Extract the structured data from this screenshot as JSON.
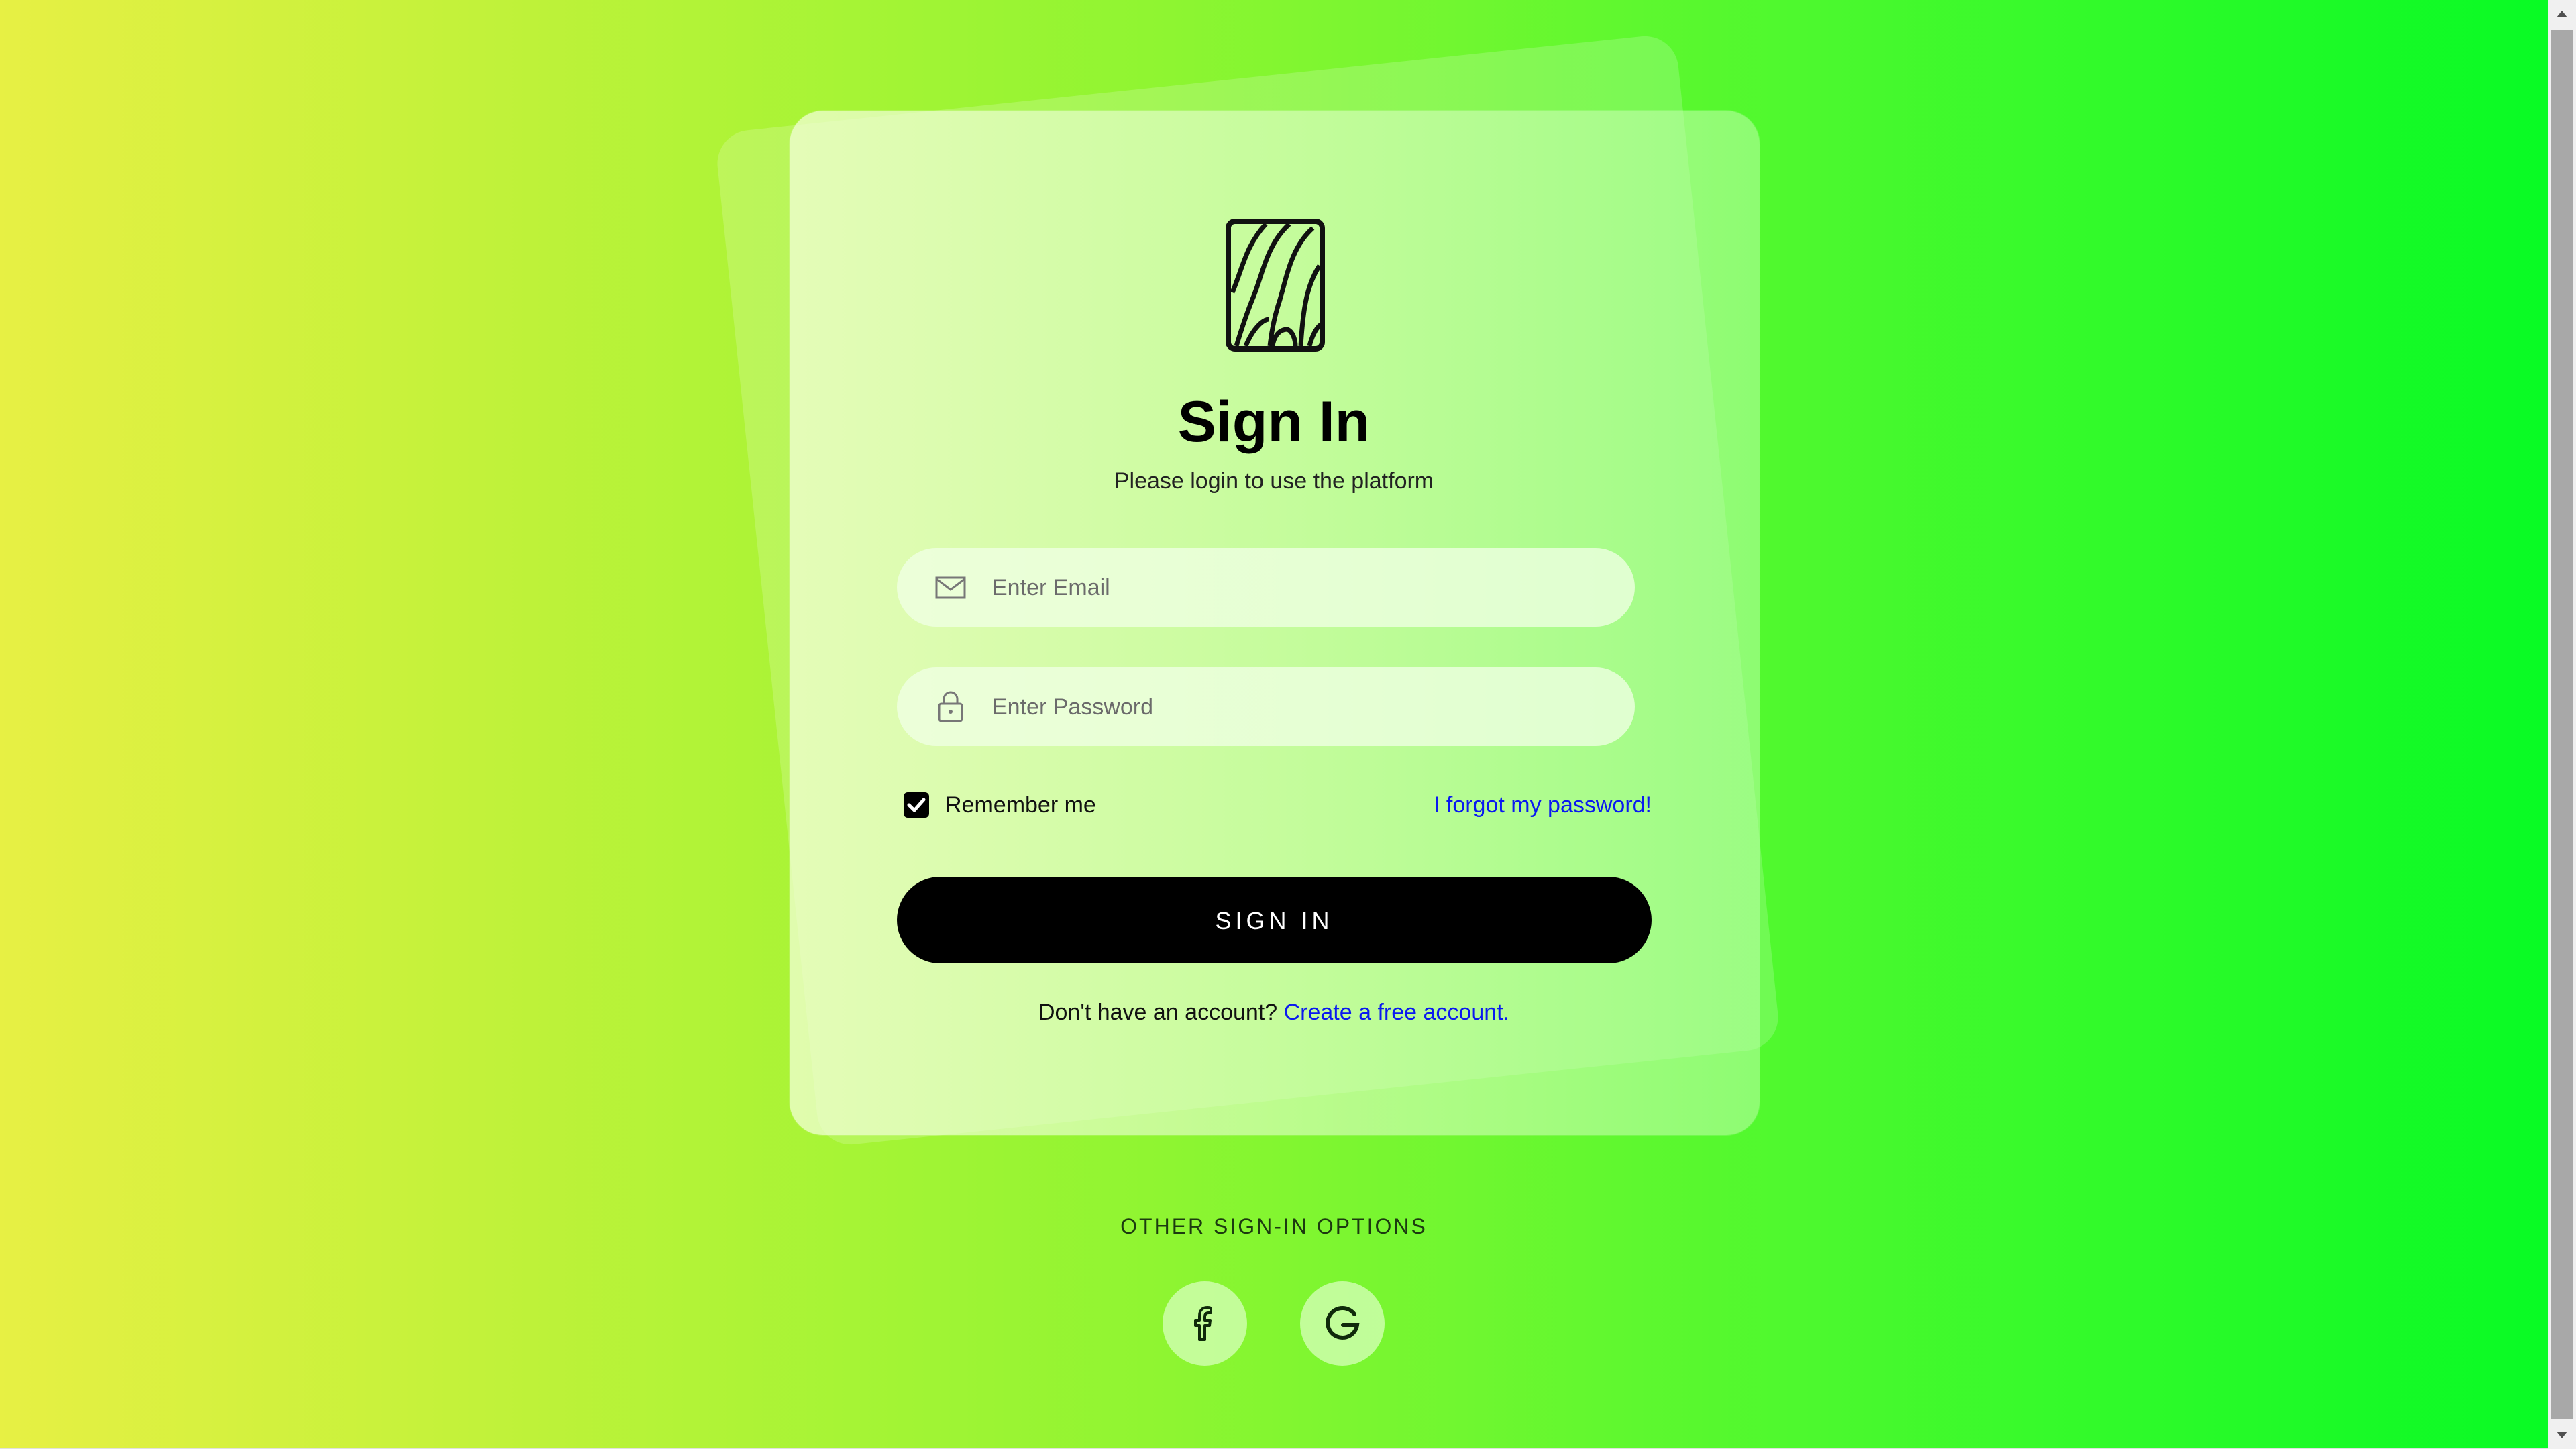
{
  "login": {
    "title": "Sign In",
    "subtitle": "Please login to use the platform",
    "email_placeholder": "Enter Email",
    "password_placeholder": "Enter Password",
    "remember_label": "Remember me",
    "remember_checked": true,
    "forgot_link": "I forgot my password!",
    "signin_button": "SIGN IN",
    "signup_prompt": "Don't have an account?",
    "signup_link": "Create a free account."
  },
  "other_options": {
    "title": "OTHER SIGN-IN OPTIONS",
    "providers": [
      {
        "icon": "facebook-icon"
      },
      {
        "icon": "google-icon"
      }
    ]
  },
  "icons": {
    "logo": "wood-grain-logo",
    "email": "mail-icon",
    "password": "lock-icon",
    "checkbox": "check-icon"
  },
  "colors": {
    "accent_link": "#0a19f0",
    "button_bg": "#000000",
    "background_start": "#e7f044",
    "background_end": "#05fb24"
  }
}
